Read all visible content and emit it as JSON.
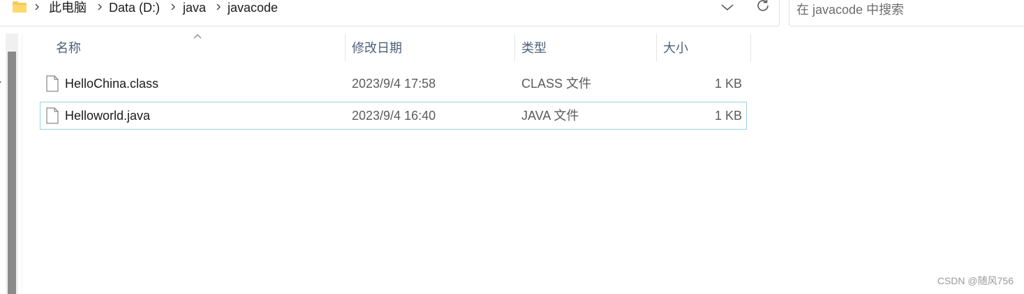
{
  "address_bar": {
    "crumbs": [
      "此电脑",
      "Data (D:)",
      "java",
      "javacode"
    ]
  },
  "search": {
    "placeholder": "在 javacode 中搜索"
  },
  "nav": {
    "partial_letter": "r"
  },
  "columns": {
    "name": "名称",
    "date": "修改日期",
    "type": "类型",
    "size": "大小"
  },
  "files": [
    {
      "name": "HelloChina.class",
      "date": "2023/9/4 17:58",
      "type": "CLASS 文件",
      "size": "1 KB",
      "selected": false
    },
    {
      "name": "Helloworld.java",
      "date": "2023/9/4 16:40",
      "type": "JAVA 文件",
      "size": "1 KB",
      "selected": true
    }
  ],
  "icons": [
    "folder-icon",
    "chevron-right-icon",
    "chevron-down-icon",
    "refresh-icon",
    "sort-up-icon",
    "file-icon"
  ],
  "colors": {
    "header_text": "#4c607a",
    "selection_border": "#99d1e4",
    "folder": "#f8c950"
  },
  "watermark": "CSDN @随风756"
}
